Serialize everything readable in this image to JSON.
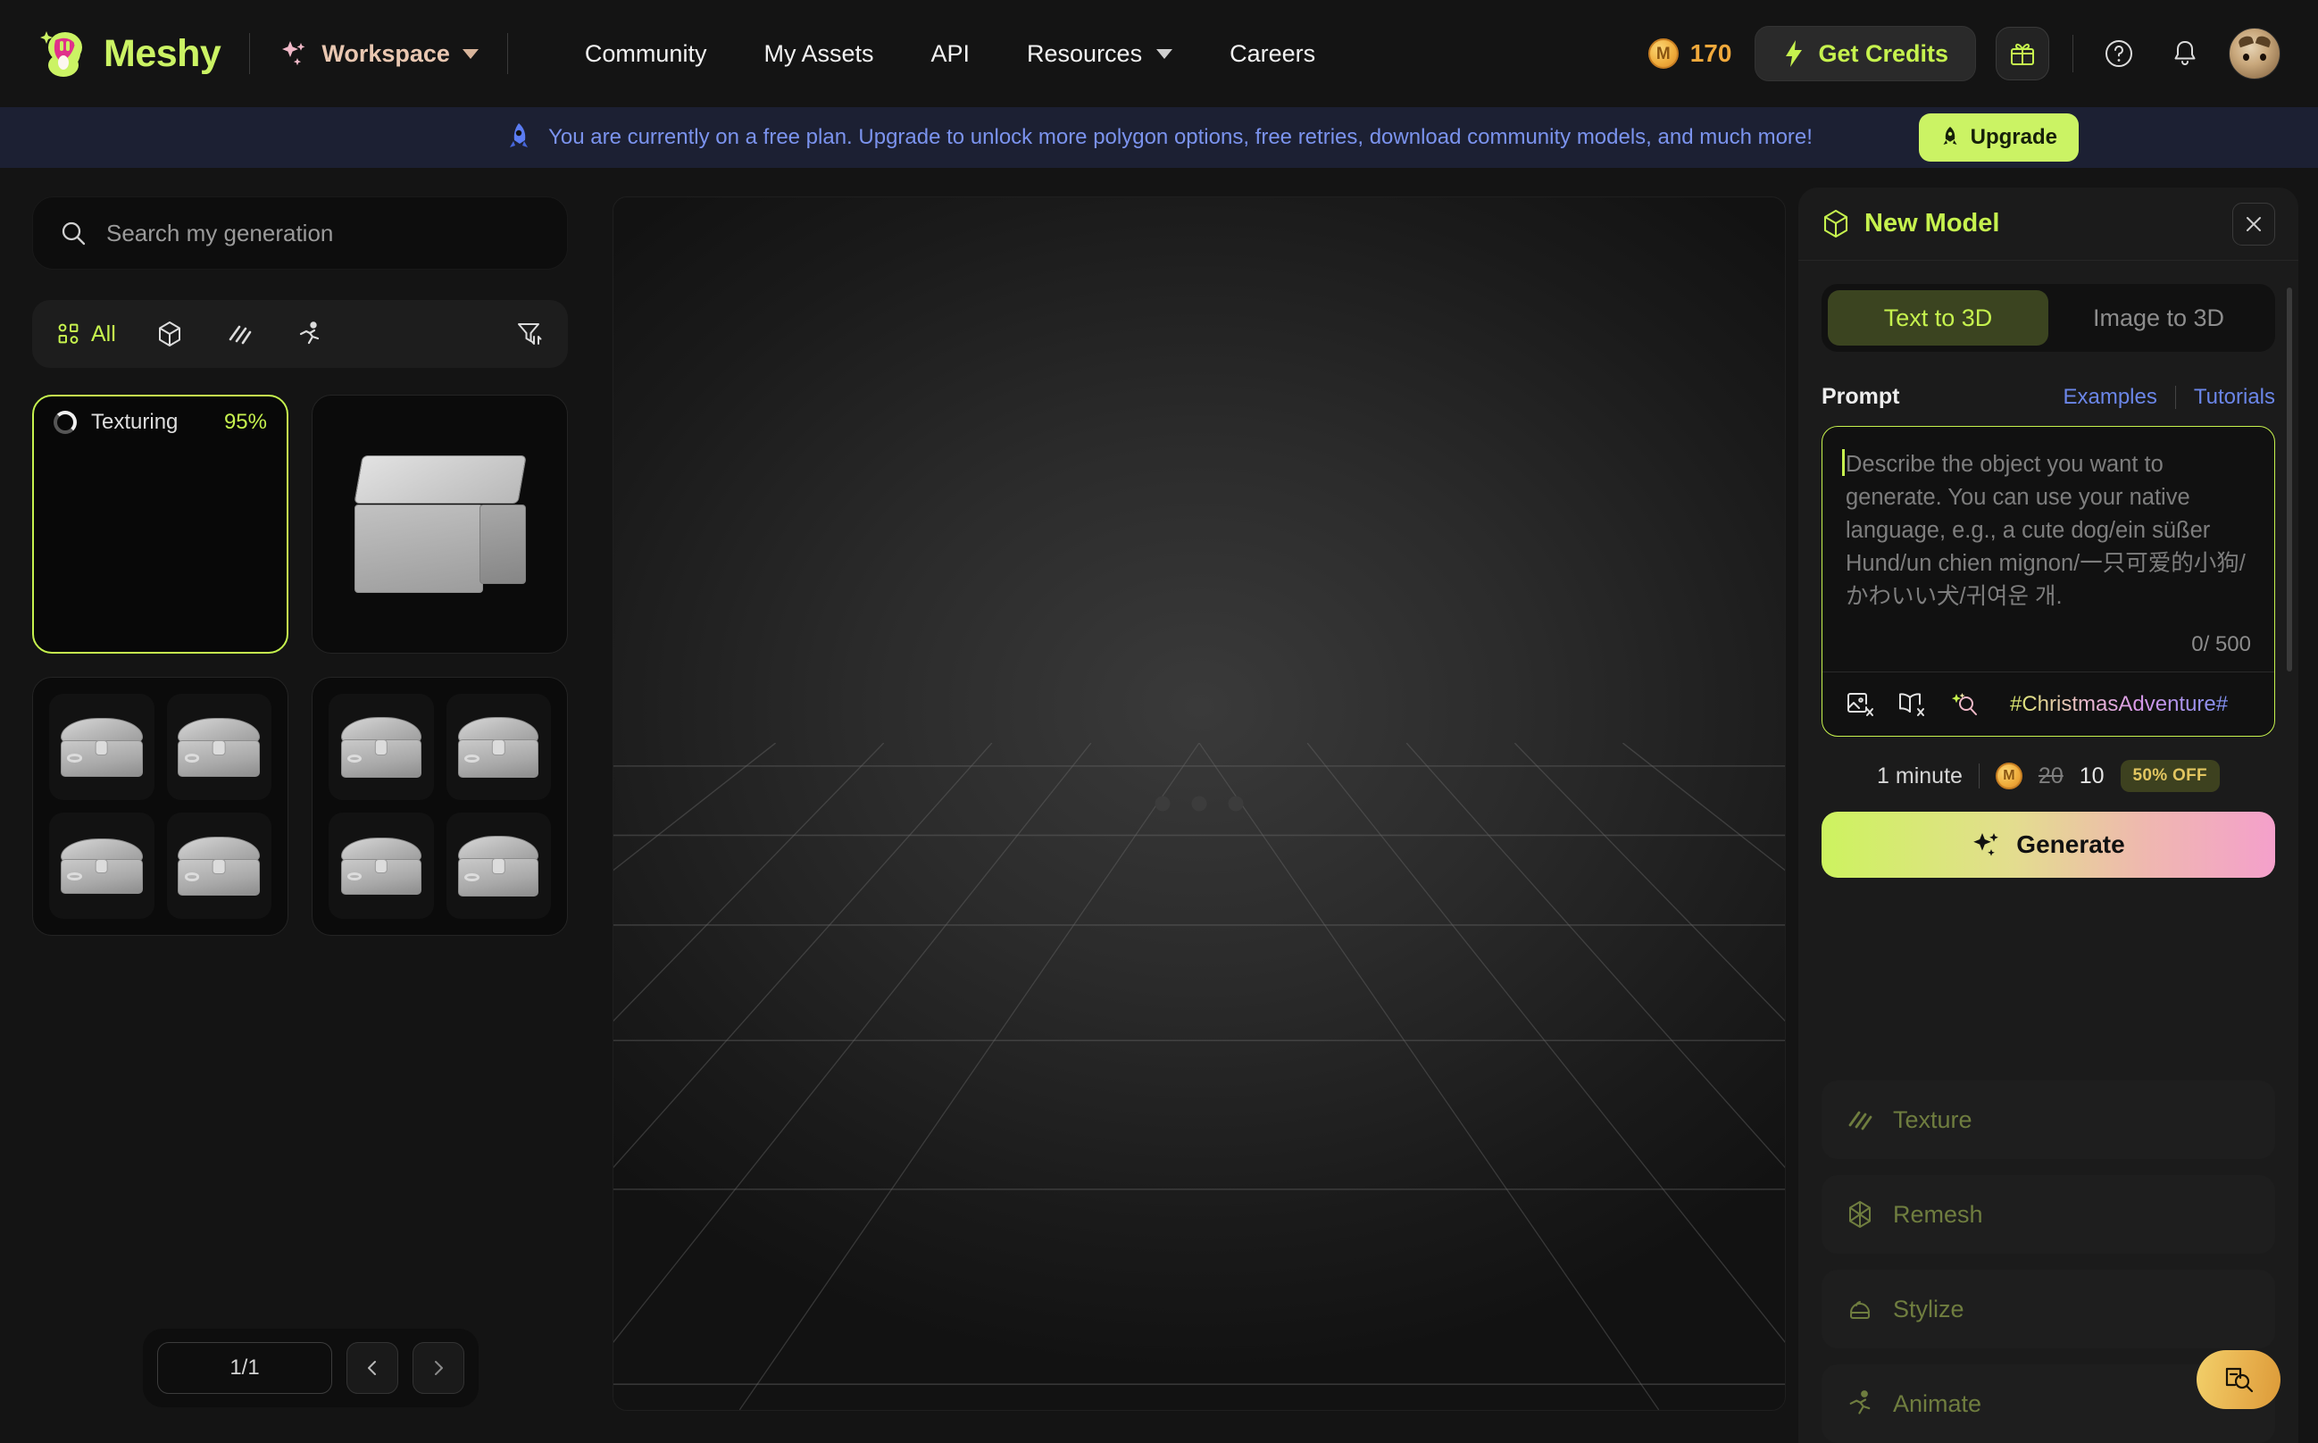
{
  "brand": {
    "name": "Meshy",
    "accent": "#c6f24e"
  },
  "topnav": {
    "workspace_label": "Workspace",
    "links": [
      {
        "label": "Community",
        "has_caret": false
      },
      {
        "label": "My Assets",
        "has_caret": false
      },
      {
        "label": "API",
        "has_caret": false
      },
      {
        "label": "Resources",
        "has_caret": true
      },
      {
        "label": "Careers",
        "has_caret": false
      }
    ],
    "credits_value": "170",
    "get_credits_label": "Get Credits",
    "gift_icon": "gift-icon",
    "help_icon": "help-circle-icon",
    "bell_icon": "bell-icon",
    "avatar_icon": "user-avatar"
  },
  "banner": {
    "text": "You are currently on a free plan. Upgrade to unlock more polygon options, free retries, download community models, and much more!",
    "upgrade_label": "Upgrade",
    "rocket_icon": "rocket-icon",
    "bg": "#1c2033",
    "text_color": "#7b93ee",
    "button_bg": "#cbf364"
  },
  "sidebar": {
    "search_placeholder": "Search my generation",
    "search_value": "",
    "search_icon": "search-icon",
    "filters": [
      {
        "name": "all",
        "label": "All",
        "icon": "grid-icon",
        "active": true
      },
      {
        "name": "model",
        "label": "",
        "icon": "cube-icon",
        "active": false
      },
      {
        "name": "texture",
        "label": "",
        "icon": "stripes-icon",
        "active": false
      },
      {
        "name": "animate",
        "label": "",
        "icon": "running-person-icon",
        "active": false
      }
    ],
    "sort_icon": "filter-sort-icon",
    "cards": [
      {
        "type": "progress",
        "status": "Texturing",
        "percent": "95%",
        "active": true,
        "spinner_icon": "loading-spinner-icon"
      },
      {
        "type": "single",
        "thumb": "metal-crate-thumbnail",
        "active": false
      },
      {
        "type": "quad",
        "thumb": "treasure-chest-quad-thumbnail",
        "active": false
      },
      {
        "type": "quad",
        "thumb": "treasure-chest-quad-thumbnail-2",
        "active": false
      }
    ],
    "pagination": {
      "page_value": "1/1",
      "prev_icon": "chevron-left-icon",
      "next_icon": "chevron-right-icon"
    }
  },
  "viewport": {
    "loading_dots": 3,
    "grid": true
  },
  "panel": {
    "title": "New Model",
    "cube_icon": "cube-icon",
    "close_icon": "close-icon",
    "tabs": [
      {
        "label": "Text to 3D",
        "active": true
      },
      {
        "label": "Image to 3D",
        "active": false
      }
    ],
    "prompt_label": "Prompt",
    "examples_label": "Examples",
    "tutorials_label": "Tutorials",
    "prompt_value": "",
    "prompt_placeholder": "Describe the object you want to generate. You can use your native language, e.g., a cute dog/ein süßer Hund/un chien mignon/一只可爱的小狗/かわいい犬/귀여운 개.",
    "char_count": "0/ 500",
    "prompt_tools": [
      {
        "name": "image-prompt-icon",
        "label": ""
      },
      {
        "name": "style-book-icon",
        "label": ""
      },
      {
        "name": "magic-search-icon",
        "label": ""
      }
    ],
    "hashtag": "#ChristmasAdventure#",
    "estimate_time": "1 minute",
    "price_old": "20",
    "price_new": "10",
    "discount_badge": "50% OFF",
    "generate_label": "Generate",
    "generate_icon": "sparkles-icon",
    "actions": [
      {
        "label": "Texture",
        "icon": "stripes-icon"
      },
      {
        "label": "Remesh",
        "icon": "remesh-icon"
      },
      {
        "label": "Stylize",
        "icon": "crystal-ball-icon"
      },
      {
        "label": "Animate",
        "icon": "running-person-icon"
      }
    ]
  },
  "fab": {
    "icon": "page-zoom-icon"
  }
}
